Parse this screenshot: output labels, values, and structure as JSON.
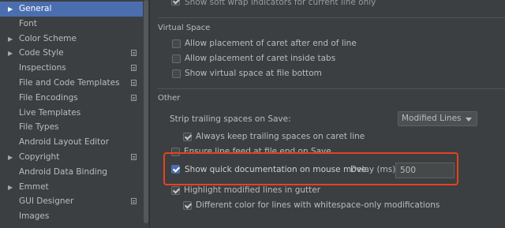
{
  "sidebar": {
    "items": [
      {
        "label": "General",
        "arrow": "▶",
        "selected": true,
        "project": false
      },
      {
        "label": "Font",
        "arrow": "",
        "selected": false,
        "project": false
      },
      {
        "label": "Color Scheme",
        "arrow": "▶",
        "selected": false,
        "project": false
      },
      {
        "label": "Code Style",
        "arrow": "▶",
        "selected": false,
        "project": true
      },
      {
        "label": "Inspections",
        "arrow": "",
        "selected": false,
        "project": true
      },
      {
        "label": "File and Code Templates",
        "arrow": "",
        "selected": false,
        "project": true
      },
      {
        "label": "File Encodings",
        "arrow": "",
        "selected": false,
        "project": true
      },
      {
        "label": "Live Templates",
        "arrow": "",
        "selected": false,
        "project": false
      },
      {
        "label": "File Types",
        "arrow": "",
        "selected": false,
        "project": false
      },
      {
        "label": "Android Layout Editor",
        "arrow": "",
        "selected": false,
        "project": false
      },
      {
        "label": "Copyright",
        "arrow": "▶",
        "selected": false,
        "project": true
      },
      {
        "label": "Android Data Binding",
        "arrow": "",
        "selected": false,
        "project": false
      },
      {
        "label": "Emmet",
        "arrow": "▶",
        "selected": false,
        "project": false
      },
      {
        "label": "GUI Designer",
        "arrow": "",
        "selected": false,
        "project": true
      },
      {
        "label": "Images",
        "arrow": "",
        "selected": false,
        "project": false
      }
    ]
  },
  "content": {
    "top_option": "Show soft wrap indicators for current line only",
    "virtual_space": {
      "title": "Virtual Space",
      "options": [
        "Allow placement of caret after end of line",
        "Allow placement of caret inside tabs",
        "Show virtual space at file bottom"
      ]
    },
    "other": {
      "title": "Other",
      "strip_label": "Strip trailing spaces on Save:",
      "strip_value": "Modified Lines",
      "always_keep": "Always keep trailing spaces on caret line",
      "ensure_line_feed": "Ensure line feed at file end on Save",
      "quick_doc": "Show quick documentation on mouse move",
      "delay_label": "Delay (ms):",
      "delay_value": "500",
      "highlight_modified": "Highlight modified lines in gutter",
      "different_color": "Different color for lines with whitespace-only modifications"
    }
  },
  "colors": {
    "selection": "#4b6eaf",
    "highlight_box": "#e4421f",
    "background": "#3c3f41"
  }
}
